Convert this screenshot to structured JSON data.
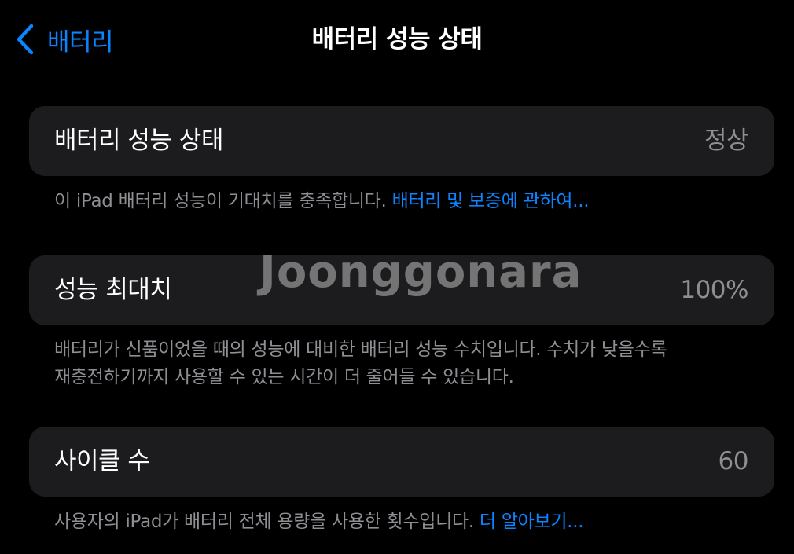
{
  "nav": {
    "back_label": "배터리",
    "title": "배터리 성능 상태"
  },
  "sections": [
    {
      "label": "배터리 성능 상태",
      "value": "정상",
      "footnote_text": "이 iPad 배터리 성능이 기대치를 충족합니다.",
      "footnote_link": "배터리 및 보증에 관하여..."
    },
    {
      "label": "성능 최대치",
      "value": "100%",
      "footnote_line1": "배터리가 신품이었을 때의 성능에 대비한 배터리 성능 수치입니다. 수치가 낮을수록",
      "footnote_line2": "재충전하기까지 사용할 수 있는 시간이 더 줄어들 수 있습니다."
    },
    {
      "label": "사이클 수",
      "value": "60",
      "footnote_text": "사용자의 iPad가 배터리 전체 용량을 사용한 횟수입니다.",
      "footnote_link": "더 알아보기..."
    }
  ],
  "watermark": "Joonggonara",
  "colors": {
    "background": "#000000",
    "cell_background": "#1c1c1e",
    "accent": "#0a84ff",
    "secondary_text": "#8e8e93",
    "primary_text": "#ffffff"
  },
  "icons": {
    "back": "chevron-left-icon"
  }
}
